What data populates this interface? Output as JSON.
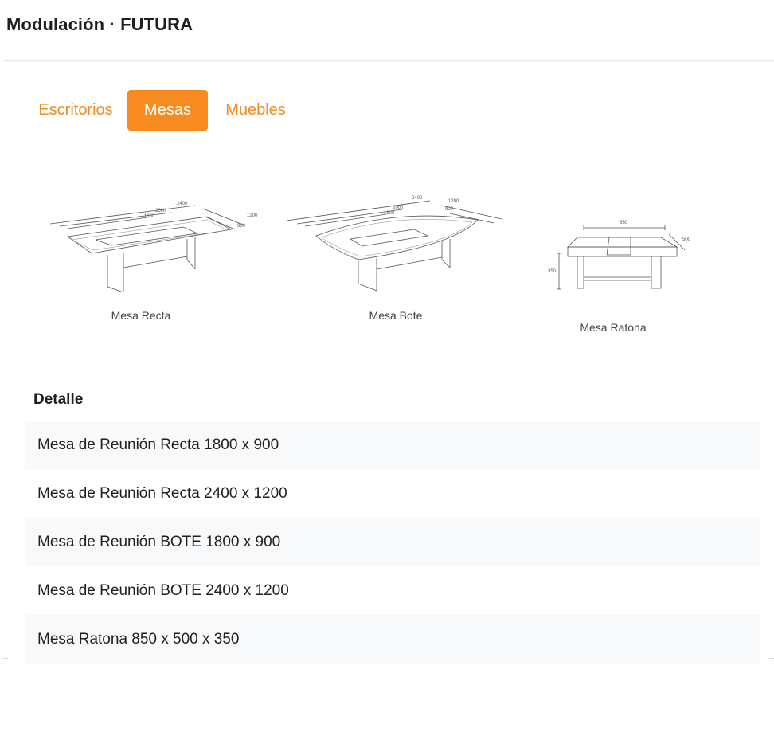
{
  "header": {
    "title": "Modulación · FUTURA"
  },
  "tabs": [
    {
      "label": "Escritorios",
      "active": false
    },
    {
      "label": "Mesas",
      "active": true
    },
    {
      "label": "Muebles",
      "active": false
    }
  ],
  "figures": [
    {
      "label": "Mesa Recta",
      "dimensions": [
        "2400",
        "2000",
        "1800",
        "1200",
        "900"
      ]
    },
    {
      "label": "Mesa Bote",
      "dimensions": [
        "2400",
        "2000",
        "1800",
        "1200",
        "900"
      ]
    },
    {
      "label": "Mesa Ratona",
      "dimensions": [
        "850",
        "500",
        "350"
      ]
    }
  ],
  "detail": {
    "title": "Detalle",
    "rows": [
      "Mesa de Reunión Recta 1800 x 900",
      "Mesa de Reunión Recta 2400 x 1200",
      "Mesa de Reunión BOTE 1800 x 900",
      "Mesa de Reunión BOTE 2400 x 1200",
      "Mesa Ratona 850 x 500 x 350"
    ]
  },
  "colors": {
    "accent": "#f78b1f",
    "tab_text": "#f08c22",
    "row_shade": "#f8f9fa"
  }
}
